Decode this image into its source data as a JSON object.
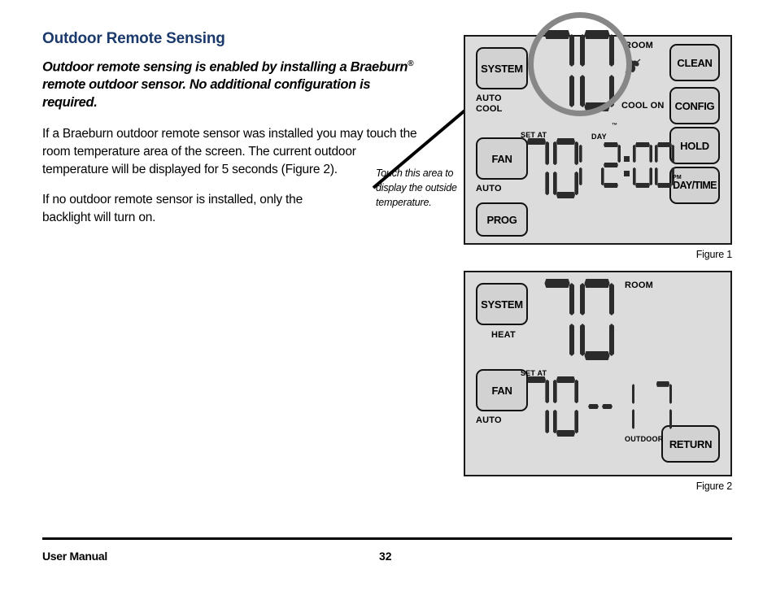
{
  "document": {
    "heading": "Outdoor Remote Sensing",
    "intro": "Outdoor remote sensing is enabled by installing a Braeburn",
    "intro_registered": "®",
    "intro_rest": "remote outdoor sensor. No additional configuration is required.",
    "paragraph_one": "If a Braeburn outdoor remote sensor was installed you may touch the room temperature area of the screen. The current outdoor temperature will be displayed for 5 seconds (Figure 2).",
    "paragraph_two": "If no outdoor remote sensor is installed, only the backlight will turn on.",
    "callout": "Touch this area to display the outside temperature.",
    "heading_color": "#1b3a6b"
  },
  "footer": {
    "left_label": "User Manual",
    "page_number": "32"
  },
  "figure_one": {
    "caption": "Figure 1",
    "buttons": {
      "system": "SYSTEM",
      "fan": "FAN",
      "prog": "PROG",
      "clean": "CLEAN",
      "config": "CONFIG",
      "hold": "HOLD",
      "daytime": "DAY/TIME"
    },
    "labels": {
      "system_mode": "AUTO\nCOOL",
      "fan_mode": "AUTO",
      "room": "ROOM",
      "cool_on": "COOL ON",
      "set_at": "SET AT",
      "day": "DAY",
      "pm": "PM",
      "trademark": "™"
    },
    "display": {
      "room_temperature": "70",
      "set_temperature": "70",
      "time": "12:00"
    },
    "icons": {
      "fan_running": "fan-running-icon",
      "highlight": "highlight-circle"
    }
  },
  "figure_two": {
    "caption": "Figure 2",
    "buttons": {
      "system": "SYSTEM",
      "fan": "FAN",
      "return": "RETURN"
    },
    "labels": {
      "system_mode": "HEAT",
      "fan_mode": "AUTO",
      "room": "ROOM",
      "set_at": "SET AT",
      "outdoor": "OUTDOOR"
    },
    "display": {
      "room_temperature": "70",
      "set_temperature": "70",
      "outdoor_temperature": "17",
      "outdoor_prefix": "--"
    }
  }
}
